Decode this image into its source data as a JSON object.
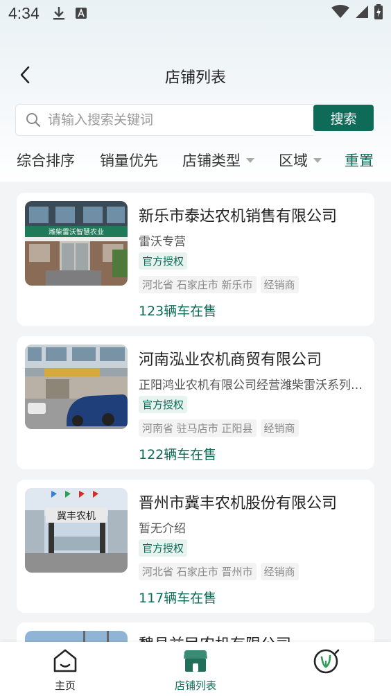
{
  "status_bar": {
    "time": "4:34"
  },
  "header": {
    "title": "店铺列表"
  },
  "search": {
    "placeholder": "请输入搜索关键词",
    "button_label": "搜索"
  },
  "filters": [
    {
      "label": "综合排序"
    },
    {
      "label": "销量优先"
    },
    {
      "label": "店铺类型"
    },
    {
      "label": "区域"
    },
    {
      "label": "重置"
    }
  ],
  "shops": [
    {
      "name": "新乐市泰达农机销售有限公司",
      "desc": "雷沃专营",
      "badge": "官方授权",
      "tags": [
        "河北省 石家庄市 新乐市",
        "经销商"
      ],
      "count": "123辆车在售",
      "sign_text": "潍柴雷沃智慧农业"
    },
    {
      "name": "河南泓业农机商贸有限公司",
      "desc": "正阳鸿业农机有限公司经营潍柴雷沃系列…",
      "badge": "官方授权",
      "tags": [
        "河南省 驻马店市 正阳县",
        "经销商"
      ],
      "count": "122辆车在售"
    },
    {
      "name": "晋州市冀丰农机股份有限公司",
      "desc": "暂无介绍",
      "badge": "官方授权",
      "tags": [
        "河北省 石家庄市 晋州市",
        "经销商"
      ],
      "count": "117辆车在售",
      "sign_text": "冀丰农机"
    },
    {
      "name": "魏县益民农机有限公司"
    }
  ],
  "bottom_nav": {
    "home_label": "主页",
    "shops_label": "店铺列表"
  },
  "colors": {
    "accent": "#0e6b57"
  }
}
